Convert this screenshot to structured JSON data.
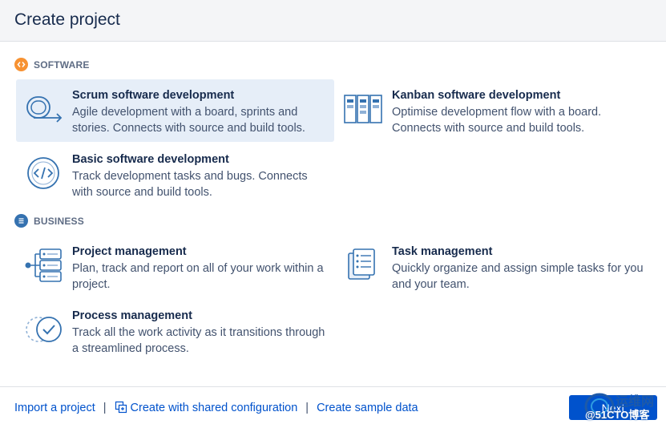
{
  "header": {
    "title": "Create project"
  },
  "sections": {
    "software": {
      "label": "SOFTWARE",
      "color": "#f79232"
    },
    "business": {
      "label": "BUSINESS",
      "color": "#3572b0"
    }
  },
  "templates": {
    "scrum": {
      "title": "Scrum software development",
      "desc": "Agile development with a board, sprints and stories. Connects with source and build tools.",
      "icon": "scrum-cycle-icon",
      "selected": true
    },
    "kanban": {
      "title": "Kanban software development",
      "desc": "Optimise development flow with a board. Connects with source and build tools.",
      "icon": "kanban-board-icon"
    },
    "basic": {
      "title": "Basic software development",
      "desc": "Track development tasks and bugs. Connects with source and build tools.",
      "icon": "code-icon"
    },
    "project": {
      "title": "Project management",
      "desc": "Plan, track and report on all of your work within a project.",
      "icon": "project-tree-icon"
    },
    "task": {
      "title": "Task management",
      "desc": "Quickly organize and assign simple tasks for you and your team.",
      "icon": "task-list-icon"
    },
    "process": {
      "title": "Process management",
      "desc": "Track all the work activity as it transitions through a streamlined process.",
      "icon": "process-check-icon"
    }
  },
  "footer": {
    "import_link": "Import a project",
    "shared_config_link": "Create with shared configuration",
    "sample_data_link": "Create sample data",
    "separator": "|",
    "next_button": "Next"
  },
  "watermark": {
    "line1": "运维网",
    "line2": "@51CTO博客"
  },
  "colors": {
    "accent": "#0052cc",
    "selected_bg": "#e6eef8",
    "icon_blue": "#3572b0"
  }
}
